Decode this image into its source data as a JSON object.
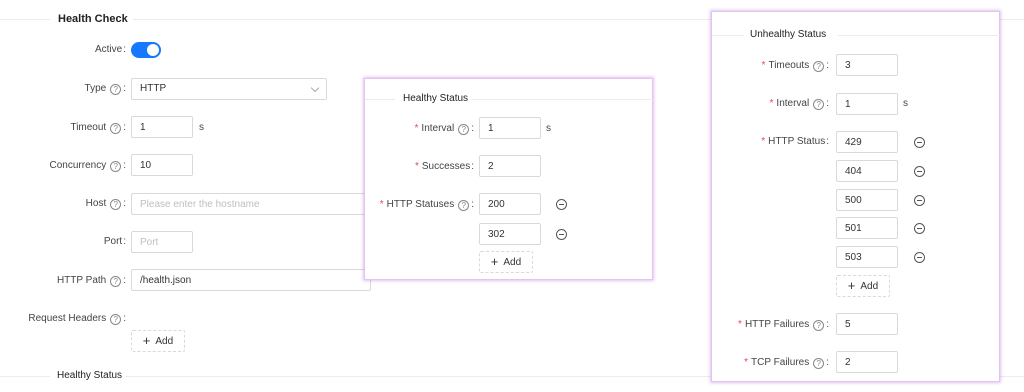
{
  "health_check": {
    "title": "Health Check",
    "active_label": "Active",
    "active_value": true,
    "type_label": "Type",
    "type_value": "HTTP",
    "timeout_label": "Timeout",
    "timeout_value": "1",
    "timeout_unit": "s",
    "concurrency_label": "Concurrency",
    "concurrency_value": "10",
    "host_label": "Host",
    "host_placeholder": "Please enter the hostname",
    "port_label": "Port",
    "port_placeholder": "Port",
    "http_path_label": "HTTP Path",
    "http_path_value": "/health.json",
    "request_headers_label": "Request Headers",
    "add_label": "Add",
    "healthy_status_section": "Healthy Status"
  },
  "healthy_popup": {
    "title": "Healthy Status",
    "interval_label": "Interval",
    "interval_value": "1",
    "interval_unit": "s",
    "successes_label": "Successes",
    "successes_value": "2",
    "http_statuses_label": "HTTP Statuses",
    "http_statuses": [
      "200",
      "302"
    ],
    "add_label": "Add"
  },
  "unhealthy_popup": {
    "title": "Unhealthy Status",
    "timeouts_label": "Timeouts",
    "timeouts_value": "3",
    "interval_label": "Interval",
    "interval_value": "1",
    "interval_unit": "s",
    "http_status_label": "HTTP Status",
    "http_statuses": [
      "429",
      "404",
      "500",
      "501",
      "503"
    ],
    "add_label": "Add",
    "http_failures_label": "HTTP Failures",
    "http_failures_value": "5",
    "tcp_failures_label": "TCP Failures",
    "tcp_failures_value": "2"
  },
  "colors": {
    "accent": "#1677ff",
    "required": "#e5484d",
    "popup_border": "#e0c6ea"
  },
  "help_icon_glyph": "?",
  "required_mark": "*",
  "plus_glyph": "+",
  "colon": ":"
}
